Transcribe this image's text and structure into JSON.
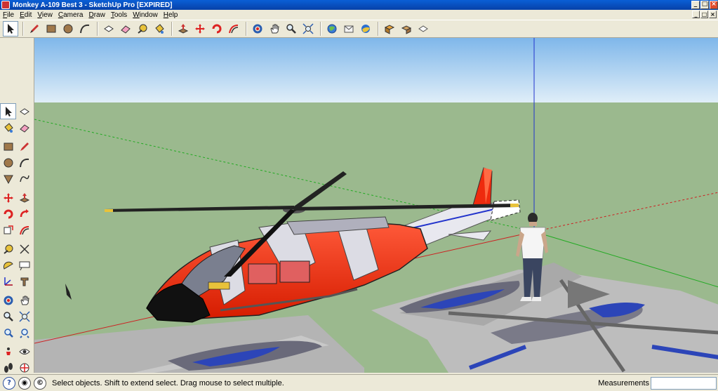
{
  "window": {
    "title": "Monkey A-109 Best 3 - SketchUp Pro [EXPIRED]",
    "minimize_label": "_",
    "maximize_label": "□",
    "close_label": "×"
  },
  "menu": {
    "items": [
      {
        "label": "File"
      },
      {
        "label": "Edit"
      },
      {
        "label": "View"
      },
      {
        "label": "Camera"
      },
      {
        "label": "Draw"
      },
      {
        "label": "Tools"
      },
      {
        "label": "Window"
      },
      {
        "label": "Help"
      }
    ]
  },
  "toolbar": {
    "tools": [
      {
        "name": "select-tool-icon"
      },
      {
        "name": "pencil-tool-icon"
      },
      {
        "name": "rectangle-tool-icon"
      },
      {
        "name": "circle-tool-icon"
      },
      {
        "name": "arc-tool-icon"
      },
      {
        "name": "make-component-icon"
      },
      {
        "name": "eraser-tool-icon"
      },
      {
        "name": "tape-measure-icon"
      },
      {
        "name": "paint-bucket-icon"
      },
      {
        "name": "push-pull-icon"
      },
      {
        "name": "move-tool-icon"
      },
      {
        "name": "rotate-tool-icon"
      },
      {
        "name": "offset-tool-icon"
      },
      {
        "name": "orbit-tool-icon"
      },
      {
        "name": "pan-tool-icon"
      },
      {
        "name": "zoom-tool-icon"
      },
      {
        "name": "zoom-extents-icon"
      },
      {
        "name": "get-models-icon"
      },
      {
        "name": "share-model-icon"
      },
      {
        "name": "google-earth-icon"
      },
      {
        "name": "get-components-icon"
      },
      {
        "name": "share-component-icon"
      },
      {
        "name": "extension-icon"
      }
    ]
  },
  "status": {
    "hint": "Select objects. Shift to extend select. Drag mouse to select multiple.",
    "measurements_label": "Measurements",
    "measurements_value": ""
  },
  "colors": {
    "sky_top": "#7fb7ea",
    "sky_bottom": "#e0eef8",
    "ground": "#9bb98e",
    "heli_red": "#ee2a0e",
    "heli_white": "#dcdce4",
    "axis_red": "#cc2222",
    "axis_green": "#22aa22",
    "axis_blue": "#2233cc"
  }
}
